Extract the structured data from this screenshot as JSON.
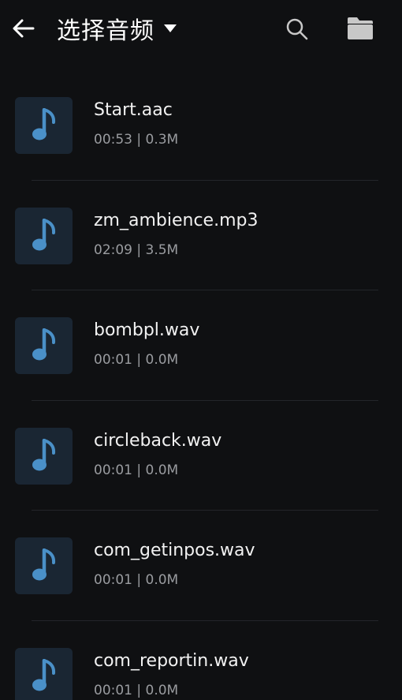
{
  "header": {
    "title": "选择音频",
    "back_icon": "arrow-left-icon",
    "dropdown_icon": "caret-down-icon",
    "search_icon": "search-icon",
    "folder_icon": "folder-icon"
  },
  "colors": {
    "background": "#0f1012",
    "thumb_bg": "#1a2633",
    "note_icon": "#4a90c8",
    "text_primary": "#f2f2f2",
    "text_secondary": "#9a9ca0",
    "icon_gray": "#c8c8c8"
  },
  "files": [
    {
      "name": "Start.aac",
      "meta": "00:53 | 0.3M",
      "icon": "music-note-icon"
    },
    {
      "name": "zm_ambience.mp3",
      "meta": "02:09 | 3.5M",
      "icon": "music-note-icon"
    },
    {
      "name": "bombpl.wav",
      "meta": "00:01 | 0.0M",
      "icon": "music-note-icon"
    },
    {
      "name": "circleback.wav",
      "meta": "00:01 | 0.0M",
      "icon": "music-note-icon"
    },
    {
      "name": "com_getinpos.wav",
      "meta": "00:01 | 0.0M",
      "icon": "music-note-icon"
    },
    {
      "name": "com_reportin.wav",
      "meta": "00:01 | 0.0M",
      "icon": "music-note-icon"
    }
  ]
}
